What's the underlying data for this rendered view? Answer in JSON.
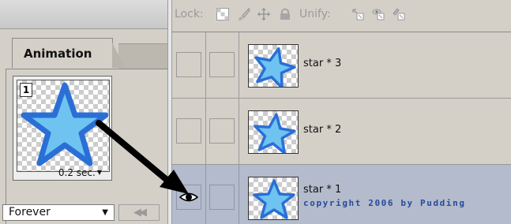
{
  "animation_panel": {
    "tab_label": "Animation",
    "frame": {
      "number": "1",
      "delay": "0.2 sec."
    },
    "loop_option": "Forever"
  },
  "layers_panel": {
    "toolbar": {
      "lock_label": "Lock:",
      "unify_label": "Unify:"
    },
    "layers": [
      {
        "name": "star * 3",
        "visible": false,
        "selected": false
      },
      {
        "name": "star * 2",
        "visible": false,
        "selected": false
      },
      {
        "name": "star * 1",
        "visible": true,
        "selected": true
      }
    ],
    "copyright_text": "copyright 2006 by Pudding"
  },
  "colors": {
    "panel_bg": "#d4d0c8",
    "selected_row": "#b3bbcc",
    "star_fill": "#6fc3f0",
    "star_stroke": "#2a6fd6",
    "watermark": "#274a9a"
  },
  "icons": [
    "eye-icon",
    "lock-transparency-icon",
    "lock-brush-icon",
    "lock-move-icon",
    "lock-all-icon",
    "unify-position-icon",
    "unify-visibility-icon",
    "unify-style-icon",
    "rewind-icon",
    "dropdown-caret-icon",
    "arrow-annotation"
  ]
}
